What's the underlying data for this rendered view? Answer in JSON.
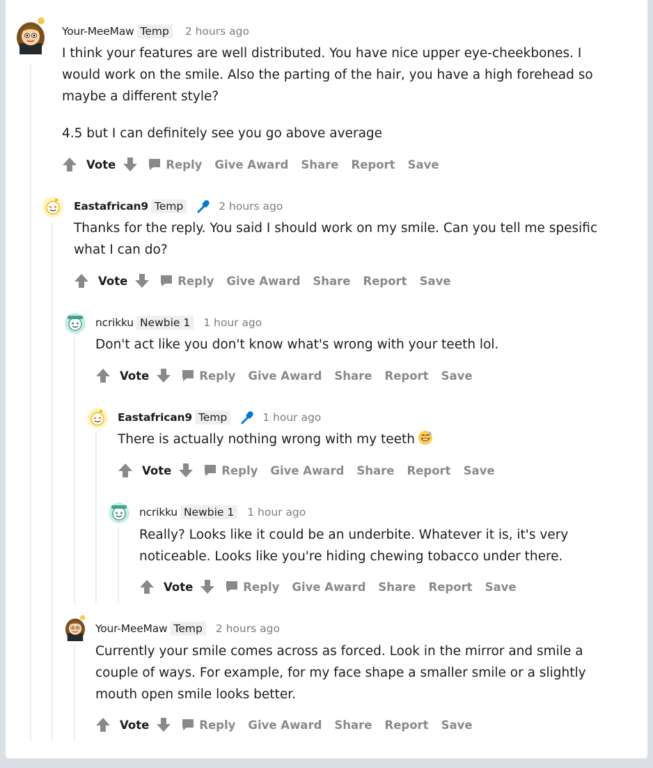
{
  "actions": {
    "vote": "Vote",
    "reply": "Reply",
    "give_award": "Give Award",
    "share": "Share",
    "report": "Report",
    "save": "Save"
  },
  "comments": [
    {
      "username": "Your-MeeMaw",
      "flair": "Temp",
      "time": "2 hours ago",
      "paragraphs": [
        "I think your features are well distributed. You have nice upper eye-cheekbones. I would work on the smile. Also the parting of the hair, you have a high forehead so maybe a different style?",
        "4.5 but I can definitely see you go above average"
      ]
    },
    {
      "username": "Eastafrican9",
      "flair": "Temp",
      "op_icon": "microphone-icon",
      "time": "2 hours ago",
      "paragraphs": [
        "Thanks for the reply. You said I should work on my smile. Can you tell me spesific what I can do?"
      ]
    },
    {
      "username": "ncrikku",
      "flair": "Newbie 1",
      "time": "1 hour ago",
      "paragraphs": [
        "Don't act like you don't know what's wrong with your teeth lol."
      ]
    },
    {
      "username": "Eastafrican9",
      "flair": "Temp",
      "op_icon": "microphone-icon",
      "time": "1 hour ago",
      "paragraphs": [
        "There is actually nothing wrong with my teeth"
      ],
      "emoji": "grinning-sweat-emoji"
    },
    {
      "username": "ncrikku",
      "flair": "Newbie 1",
      "time": "1 hour ago",
      "paragraphs": [
        "Really? Looks like it could be an underbite. Whatever it is, it's very noticeable. Looks like you're hiding chewing tobacco under there."
      ]
    },
    {
      "username": "Your-MeeMaw",
      "flair": "Temp",
      "time": "2 hours ago",
      "paragraphs": [
        "Currently your smile comes across as forced. Look in the mirror and smile a couple of ways. For example, for my face shape a smaller smile or a slightly mouth open smile looks better."
      ]
    }
  ],
  "colors": {
    "background": "#dae0e6",
    "card": "#ffffff",
    "action_gray": "#878a8c",
    "thread_line": "#edeff1",
    "op_blue": "#0079d3"
  }
}
